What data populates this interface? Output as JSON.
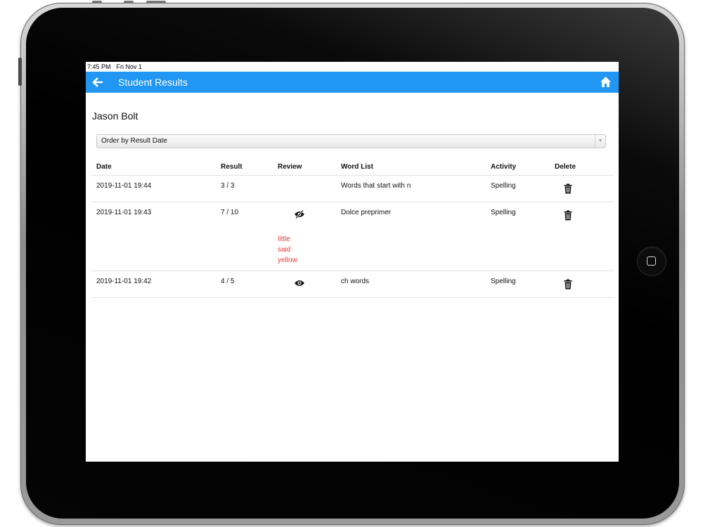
{
  "status_bar": {
    "time": "7:45 PM",
    "date": "Fri Nov 1"
  },
  "nav": {
    "title": "Student Results",
    "bar_color": "#2196f3",
    "back_icon": "arrow-left-icon",
    "home_icon": "home-icon"
  },
  "student": {
    "name": "Jason Bolt"
  },
  "order_select": {
    "selected": "Order by Result Date"
  },
  "table": {
    "headers": {
      "date": "Date",
      "result": "Result",
      "review": "Review",
      "word_list": "Word List",
      "activity": "Activity",
      "delete": "Delete"
    },
    "rows": [
      {
        "date": "2019-11-01 19:44",
        "result": "3 / 3",
        "review_icon": "",
        "missed_words": [],
        "word_list": "Words that start with n",
        "activity": "Spelling"
      },
      {
        "date": "2019-11-01 19:43",
        "result": "7 / 10",
        "review_icon": "eye-slash-icon",
        "missed_words": [
          "little",
          "said",
          "yellow"
        ],
        "word_list": "Dolce preprimer",
        "activity": "Spelling"
      },
      {
        "date": "2019-11-01 19:42",
        "result": "4 / 5",
        "review_icon": "eye-icon",
        "missed_words": [],
        "word_list": "ch words",
        "activity": "Spelling"
      }
    ]
  },
  "colors": {
    "missed_word": "#e53935",
    "accent": "#2196f3"
  }
}
